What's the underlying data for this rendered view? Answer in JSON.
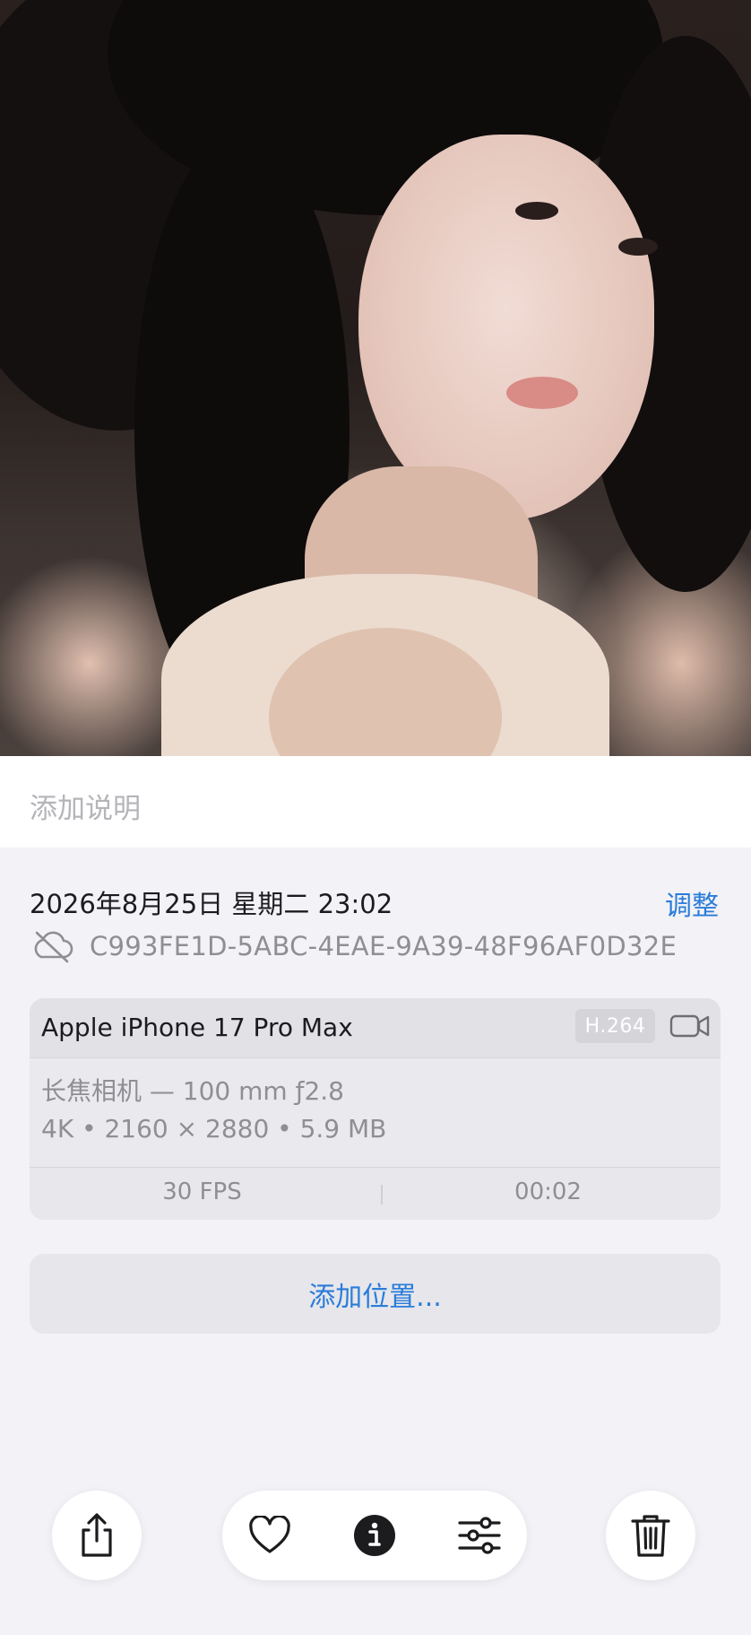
{
  "caption": {
    "placeholder": "添加说明"
  },
  "info": {
    "date": "2026年8月25日 星期二 23:02",
    "adjust_label": "调整",
    "uuid": "C993FE1D-5ABC-4EAE-9A39-48F96AF0D32E",
    "cloud_icon": "cloud-slash-icon"
  },
  "camera": {
    "device": "Apple iPhone 17 Pro Max",
    "codec": "H.264",
    "media_icon": "video-camera-icon",
    "lens": "长焦相机 — 100 mm ƒ2.8",
    "specs": "4K • 2160 × 2880 • 5.9 MB",
    "fps": "30 FPS",
    "duration": "00:02"
  },
  "location": {
    "label": "添加位置..."
  },
  "toolbar": {
    "icons": [
      "share-icon",
      "heart-icon",
      "info-icon",
      "adjust-sliders-icon",
      "trash-icon"
    ]
  },
  "colors": {
    "accent": "#2a7cd9",
    "background": "#f2f2f7",
    "secondary_text": "#8e8e93"
  }
}
